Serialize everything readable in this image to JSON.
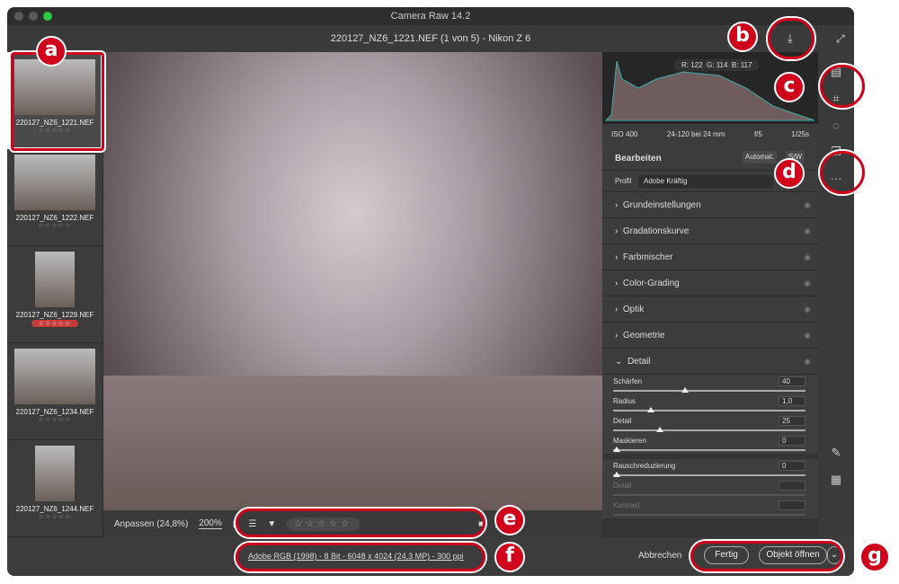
{
  "window": {
    "title": "Camera Raw 14.2",
    "file_title": "220127_NZ6_1221.NEF (1 von 5) - Nikon Z 6"
  },
  "filmstrip": [
    {
      "name": "220127_NZ6_1221.NEF",
      "stars": "☆☆☆☆☆"
    },
    {
      "name": "220127_NZ6_1222.NEF",
      "stars": "☆☆☆☆☆"
    },
    {
      "name": "220127_NZ6_1229.NEF",
      "stars": "☆☆☆☆☆"
    },
    {
      "name": "220127_NZ6_1234.NEF",
      "stars": "☆☆☆☆☆"
    },
    {
      "name": "220127_NZ6_1244.NEF",
      "stars": "☆☆☆☆☆"
    }
  ],
  "toolbar": {
    "fit": "Anpassen (24,8%)",
    "zoom": "200%",
    "stars": "☆☆☆☆☆"
  },
  "footer": {
    "info": "Adobe RGB (1998) - 8 Bit - 6048 x 4024 (24,3 MP) - 300 ppi",
    "cancel": "Abbrechen",
    "done": "Fertig",
    "open": "Objekt öffnen"
  },
  "histogram": {
    "r": "R: 122",
    "g": "G: 114",
    "b": "B: 117"
  },
  "exif": {
    "iso": "ISO 400",
    "lens": "24-120 bei 24 mm",
    "aperture": "f/5",
    "shutter": "1/25s"
  },
  "edit": {
    "title": "Bearbeiten",
    "auto": "Automat.",
    "bw": "S/W",
    "profile_label": "Profil",
    "profile": "Adobe Kräftig"
  },
  "sections": [
    "Grundeinstellungen",
    "Gradationskurve",
    "Farbmischer",
    "Color-Grading",
    "Optik",
    "Geometrie"
  ],
  "detail": {
    "title": "Detail",
    "sliders": [
      {
        "label": "Schärfen",
        "value": "40",
        "pos": 0.4
      },
      {
        "label": "Radius",
        "value": "1,0",
        "pos": 0.2
      },
      {
        "label": "Detail",
        "value": "25",
        "pos": 0.25
      },
      {
        "label": "Maskieren",
        "value": "0",
        "pos": 0
      }
    ],
    "noise": {
      "label": "Rauschreduzierung",
      "value": "0",
      "pos": 0
    },
    "disabled": [
      "Detail",
      "Kontrast"
    ]
  },
  "markers": [
    "a",
    "b",
    "c",
    "d",
    "e",
    "f",
    "g"
  ]
}
